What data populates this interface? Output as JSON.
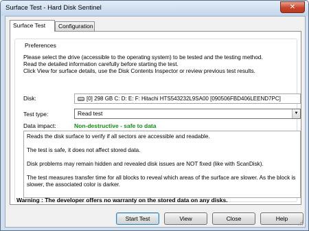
{
  "window": {
    "title": "Surface Test - Hard Disk Sentinel",
    "close_glyph": "✕"
  },
  "tabs": [
    {
      "label": "Surface Test",
      "active": true
    },
    {
      "label": "Configuration",
      "active": false
    }
  ],
  "preferences": {
    "group_label": "Preferences",
    "intro_lines": [
      "Please select the drive (accessible to the operating system) to be tested and the testing method.",
      "Read the detailed information carefully before starting the test.",
      "Click View for surface details, use the Disk Contents Inspector or review previous test results."
    ],
    "disk_label": "Disk:",
    "disk_value": "[0]   298 GB   C: D: E: F:   Hitachi HTS543232L9SA00 [090506FBD406LEEND7PC]",
    "test_type_label": "Test type:",
    "test_type_value": "Read test",
    "data_impact_label": "Data impact:",
    "data_impact_value": "Non-destructive - safe to data",
    "description": [
      "Reads the disk surface to verify if all sectors are accessible and readable.",
      "The test is safe, it does not affect stored data.",
      "Disk problems may remain hidden and revealed disk issues are NOT fixed (like with ScanDisk).",
      "The test measures transfer time for all blocks to reveal which areas of the surface are slower. As the block is slower, the associated color is darker."
    ]
  },
  "warning": "Warning : The developer offers no warranty on the stored data on any disks.",
  "buttons": {
    "start_test": "Start Test",
    "view": "View",
    "close": "Close",
    "help": "Help"
  },
  "colors": {
    "impact_green": "#168a16",
    "close_button_red": "#c7452b",
    "default_button_border": "#3c7fb1"
  }
}
